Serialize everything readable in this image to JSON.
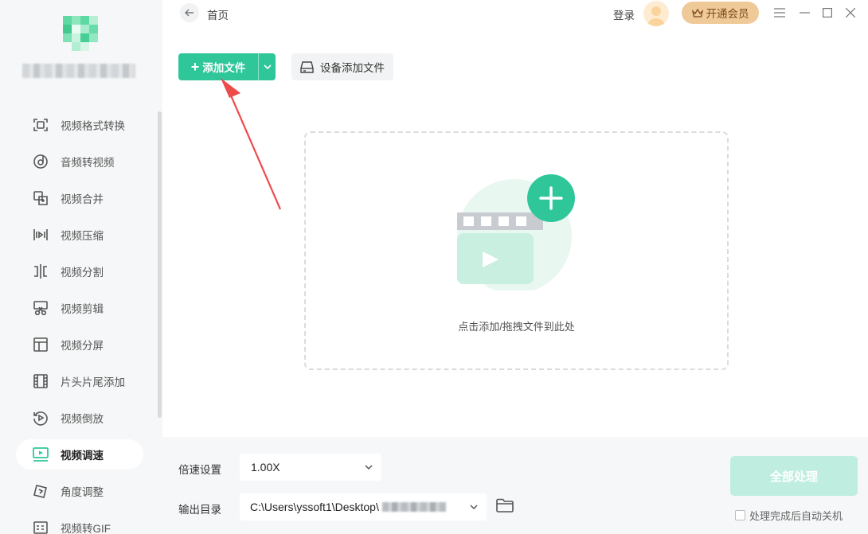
{
  "header": {
    "breadcrumb": "首页",
    "login_label": "登录",
    "vip_label": "开通会员"
  },
  "sidebar": {
    "items": [
      {
        "label": "视频格式转换",
        "icon": "format-convert-icon",
        "active": false
      },
      {
        "label": "音频转视频",
        "icon": "audio-to-video-icon",
        "active": false
      },
      {
        "label": "视频合并",
        "icon": "merge-icon",
        "active": false
      },
      {
        "label": "视频压缩",
        "icon": "compress-icon",
        "active": false
      },
      {
        "label": "视频分割",
        "icon": "split-icon",
        "active": false
      },
      {
        "label": "视频剪辑",
        "icon": "scissors-icon",
        "active": false
      },
      {
        "label": "视频分屏",
        "icon": "split-screen-icon",
        "active": false
      },
      {
        "label": "片头片尾添加",
        "icon": "film-strip-icon",
        "active": false
      },
      {
        "label": "视频倒放",
        "icon": "reverse-icon",
        "active": false
      },
      {
        "label": "视频调速",
        "icon": "speed-monitor-icon",
        "active": true
      },
      {
        "label": "角度调整",
        "icon": "rotate-icon",
        "active": false
      },
      {
        "label": "视频转GIF",
        "icon": "gif-icon",
        "active": false
      }
    ]
  },
  "toolbar": {
    "add_file_label": "添加文件",
    "device_add_label": "设备添加文件"
  },
  "dropzone": {
    "hint": "点击添加/拖拽文件到此处"
  },
  "bottom": {
    "speed_label": "倍速设置",
    "speed_value": "1.00X",
    "output_label": "输出目录",
    "output_path": "C:\\Users\\yssoft1\\Desktop\\",
    "process_label": "全部处理",
    "auto_shutdown_label": "处理完成后自动关机"
  },
  "colors": {
    "accent": "#2fc69a",
    "accent_light": "#bfeee0",
    "vip": "#f0c999"
  }
}
